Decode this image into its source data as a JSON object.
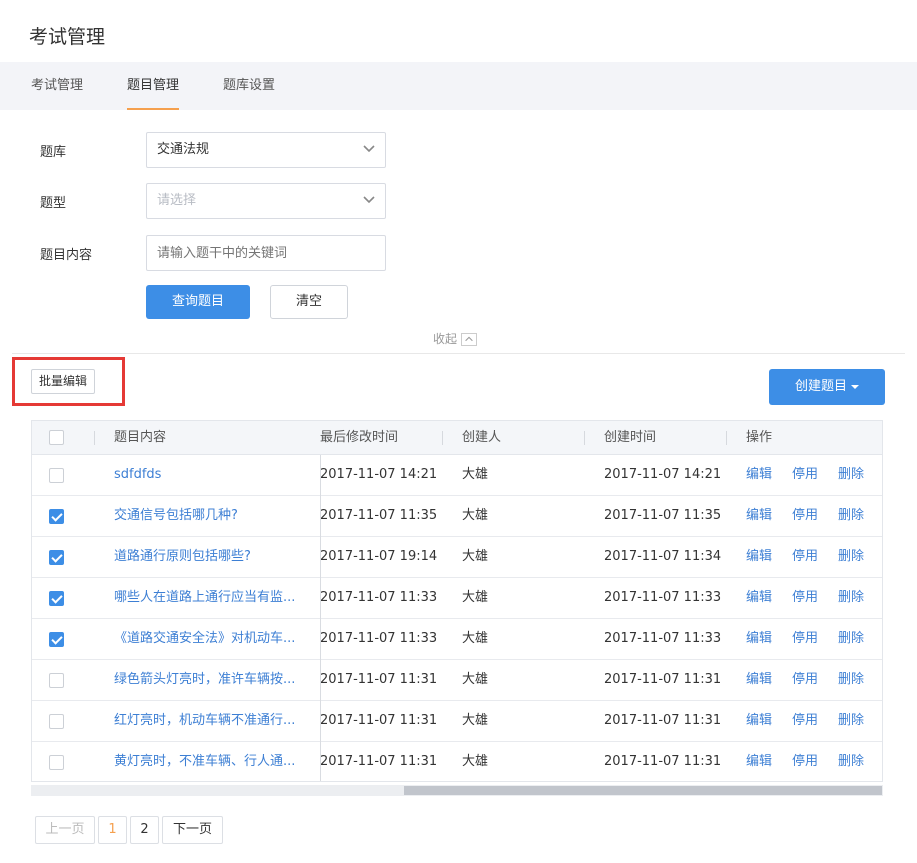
{
  "page": {
    "title": "考试管理"
  },
  "tabs": [
    {
      "label": "考试管理",
      "active": false
    },
    {
      "label": "题目管理",
      "active": true
    },
    {
      "label": "题库设置",
      "active": false
    }
  ],
  "filters": {
    "bank": {
      "label": "题库",
      "value": "交通法规"
    },
    "type": {
      "label": "题型",
      "placeholder": "请选择"
    },
    "content": {
      "label": "题目内容",
      "placeholder": "请输入题干中的关键词"
    },
    "query_button": "查询题目",
    "clear_button": "清空",
    "collapse_label": "收起"
  },
  "toolbar": {
    "batch_edit": "批量编辑",
    "create": "创建题目"
  },
  "table": {
    "columns": [
      "题目内容",
      "最后修改时间",
      "创建人",
      "创建时间",
      "操作"
    ],
    "actions": [
      "编辑",
      "停用",
      "删除"
    ],
    "rows": [
      {
        "checked": false,
        "content": "sdfdfds",
        "modified": "2017-11-07 14:21",
        "creator": "大雄",
        "created": "2017-11-07 14:21"
      },
      {
        "checked": true,
        "content": "交通信号包括哪几种?",
        "modified": "2017-11-07 11:35",
        "creator": "大雄",
        "created": "2017-11-07 11:35"
      },
      {
        "checked": true,
        "content": "道路通行原则包括哪些?",
        "modified": "2017-11-07 19:14",
        "creator": "大雄",
        "created": "2017-11-07 11:34"
      },
      {
        "checked": true,
        "content": "哪些人在道路上通行应当有监...",
        "modified": "2017-11-07 11:33",
        "creator": "大雄",
        "created": "2017-11-07 11:33"
      },
      {
        "checked": true,
        "content": "《道路交通安全法》对机动车...",
        "modified": "2017-11-07 11:33",
        "creator": "大雄",
        "created": "2017-11-07 11:33"
      },
      {
        "checked": false,
        "content": "绿色箭头灯亮时，准许车辆按...",
        "modified": "2017-11-07 11:31",
        "creator": "大雄",
        "created": "2017-11-07 11:31"
      },
      {
        "checked": false,
        "content": "红灯亮时，机动车辆不准通行...",
        "modified": "2017-11-07 11:31",
        "creator": "大雄",
        "created": "2017-11-07 11:31"
      },
      {
        "checked": false,
        "content": "黄灯亮时，不准车辆、行人通...",
        "modified": "2017-11-07 11:31",
        "creator": "大雄",
        "created": "2017-11-07 11:31"
      }
    ]
  },
  "pagination": {
    "prev": "上一页",
    "pages": [
      "1",
      "2"
    ],
    "current": "1",
    "next": "下一页"
  },
  "colors": {
    "primary": "#3d8ee6",
    "link": "#3d7fd4",
    "accent": "#f5a04e",
    "highlight": "#e53935"
  }
}
